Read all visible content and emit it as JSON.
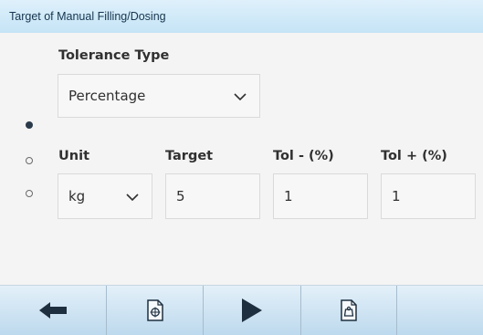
{
  "window": {
    "title": "Target of Manual Filling/Dosing"
  },
  "tolerance_type": {
    "label": "Tolerance Type",
    "value": "Percentage"
  },
  "fields": {
    "unit": {
      "label": "Unit",
      "value": "kg"
    },
    "target": {
      "label": "Target",
      "value": "5"
    },
    "tol_minus": {
      "label": "Tol - (%)",
      "value": "1"
    },
    "tol_plus": {
      "label": "Tol + (%)",
      "value": "1"
    }
  },
  "page_indicator": {
    "pages": 3,
    "current": 1
  },
  "toolbar": {
    "buttons": [
      {
        "icon": "arrow-left-icon"
      },
      {
        "icon": "target-document-icon"
      },
      {
        "icon": "play-icon"
      },
      {
        "icon": "weigh-document-icon"
      },
      {
        "icon": ""
      }
    ]
  },
  "colors": {
    "title_bar": "#c5e4f6",
    "toolbar": "#bdd9ed",
    "background": "#f4f4f4",
    "icon_dark": "#1e2f3f"
  }
}
